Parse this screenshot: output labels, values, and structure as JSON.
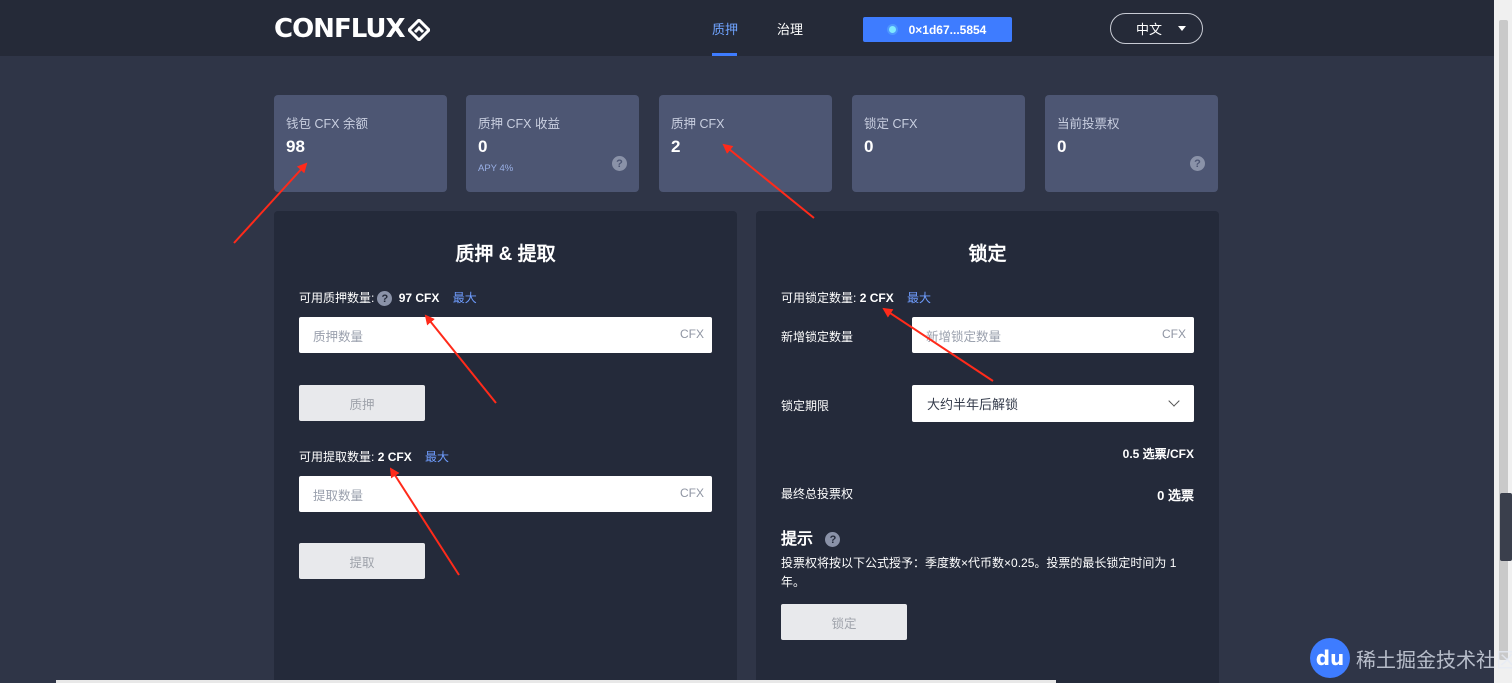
{
  "header": {
    "logo_text": "CONFLUX",
    "nav": [
      {
        "label": "质押",
        "active": true
      },
      {
        "label": "治理",
        "active": false
      }
    ],
    "wallet_address": "0×1d67...5854",
    "language": "中文"
  },
  "stats": [
    {
      "label": "钱包 CFX 余额",
      "value": "98"
    },
    {
      "label": "质押 CFX 收益",
      "value": "0",
      "sub": "APY 4%"
    },
    {
      "label": "质押 CFX",
      "value": "2"
    },
    {
      "label": "锁定 CFX",
      "value": "0"
    },
    {
      "label": "当前投票权",
      "value": "0"
    }
  ],
  "stake_panel": {
    "title": "质押 & 提取",
    "available_stake_label": "可用质押数量:",
    "available_stake_value": "97 CFX",
    "max_label": "最大",
    "stake_input_placeholder": "质押数量",
    "unit": "CFX",
    "stake_button": "质押",
    "available_withdraw_label": "可用提取数量:",
    "available_withdraw_value": "2 CFX",
    "withdraw_input_placeholder": "提取数量",
    "withdraw_button": "提取"
  },
  "lock_panel": {
    "title": "锁定",
    "available_lock_label": "可用锁定数量:",
    "available_lock_value": "2 CFX",
    "max_label": "最大",
    "new_lock_label": "新增锁定数量",
    "new_lock_placeholder": "新增锁定数量",
    "unit": "CFX",
    "lock_period_label": "锁定期限",
    "lock_period_value": "大约半年后解锁",
    "rate": "0.5 选票/CFX",
    "final_votes_label": "最终总投票权",
    "final_votes_value": "0 选票",
    "tip_title": "提示",
    "tip_text": "投票权将按以下公式授予：季度数×代币数×0.25。投票的最长锁定时间为 1 年。",
    "lock_button": "锁定"
  },
  "watermark": {
    "badge": "du",
    "text": "稀土掘金技术社区"
  },
  "colors": {
    "background": "#2f3547",
    "header": "#252a38",
    "card": "#4d5673",
    "panel": "#242a3a",
    "accent": "#3e7cff",
    "annotation": "#ff2a1a"
  }
}
